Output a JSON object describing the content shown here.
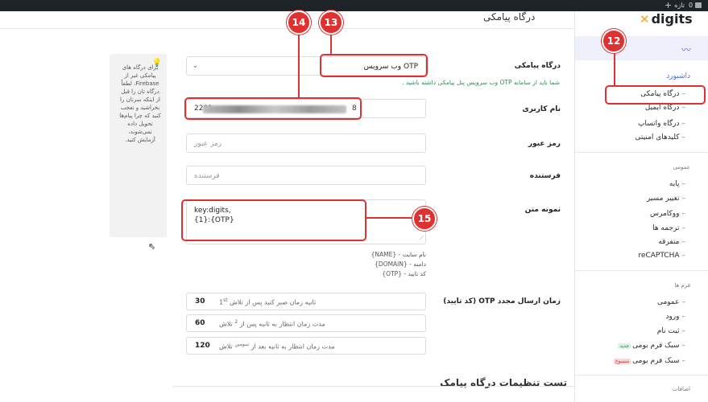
{
  "admin_bar": {
    "new_label": "تازه",
    "comments_count": "0"
  },
  "sidebar": {
    "logo_text": "digits",
    "dashboard_label": "داشبورد",
    "nav": [
      {
        "label": "درگاه پیامکی"
      },
      {
        "label": "درگاه ایمیل"
      },
      {
        "label": "درگاه واتساپ"
      },
      {
        "label": "کلیدهای امنیتی"
      }
    ],
    "general_title": "عمومی",
    "general_items": [
      {
        "label": "پایه"
      },
      {
        "label": "تغییر مسیر"
      },
      {
        "label": "ووکامرس"
      },
      {
        "label": "ترجمه ها"
      },
      {
        "label": "متفرقه"
      },
      {
        "label": "reCAPTCHA"
      }
    ],
    "forms_title": "فرم ها",
    "forms_items": [
      {
        "label": "عمومی"
      },
      {
        "label": "ورود"
      },
      {
        "label": "ثبت نام"
      },
      {
        "label": "سبک فرم بومی",
        "badge": "جدید"
      },
      {
        "label": "سبک فرم بومی",
        "badge": "منسوخ"
      }
    ],
    "addons_title": "اضافات"
  },
  "main": {
    "page_title": "درگاه پیامکی",
    "gateway": {
      "label": "درگاه پیامکی",
      "selected": "OTP وب سرویس",
      "hint": "شما باید از سامانه OTP وب سرویس پنل پیامکی داشته باشید ."
    },
    "username": {
      "label": "نام کاربری",
      "value_start": "2291",
      "value_end": "8"
    },
    "password": {
      "label": "رمز عبور",
      "placeholder": "رمز عبور"
    },
    "sender": {
      "label": "فرستنده",
      "placeholder": "فرستنده"
    },
    "template": {
      "label": "نمونه متن",
      "line1": "key:digits,",
      "line2": "{1}:{OTP}",
      "placeholders": [
        "نام سایت - {NAME}",
        "دامنه - {DOMAIN}",
        "کد تایید - {OTP}"
      ]
    },
    "resend": {
      "label": "زمان ارسال مجدد OTP (کد تایید)",
      "rows": [
        {
          "value": "30",
          "text": "ثانیه زمان صبر کنید پس از تلاش",
          "ordinal": "1",
          "sup": "st"
        },
        {
          "value": "60",
          "text": "مدت زمان انتظار به ثانیه پس از",
          "ordinal": "2",
          "suffix": "تلاش"
        },
        {
          "value": "120",
          "text": "مدت زمان انتظار به ثانیه بعد از",
          "sup": "سومین",
          "suffix": "تلاش"
        }
      ]
    },
    "test_section_title": "تست تنظیمات درگاه پیامک",
    "tip": "برای درگاه های پیامکی غیر از Firebase، لطفاً درگاه تان را قبل از اینکه سرتان را بخراشید و تعجب کنید که چرا پیام‌ها تحویل داده نمی‌شوند، آزمایش کنید."
  },
  "annotations": [
    "12",
    "13",
    "14",
    "15"
  ],
  "colors": {
    "annotation": "#e03131",
    "accent": "#6b5bd2",
    "hint_green": "#2e8b57"
  }
}
